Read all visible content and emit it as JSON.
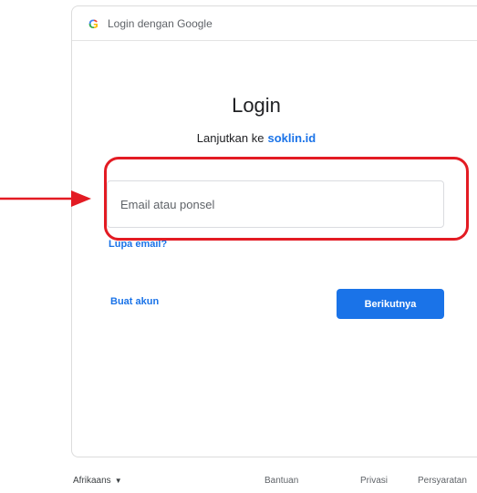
{
  "header": {
    "logo_letter": "G",
    "title": "Login dengan Google"
  },
  "main": {
    "title": "Login",
    "subtitle_prefix": "Lanjutkan ke",
    "site": "soklin.id",
    "email_placeholder": "Email atau ponsel",
    "email_value": "",
    "forgot_email": "Lupa email?",
    "create_account": "Buat akun",
    "next_button": "Berikutnya"
  },
  "footer": {
    "language": "Afrikaans",
    "links": [
      "Bantuan",
      "Privasi",
      "Persyaratan"
    ]
  },
  "annotation": {
    "color": "#e31b23"
  },
  "colors": {
    "accent": "#1a73e8"
  }
}
